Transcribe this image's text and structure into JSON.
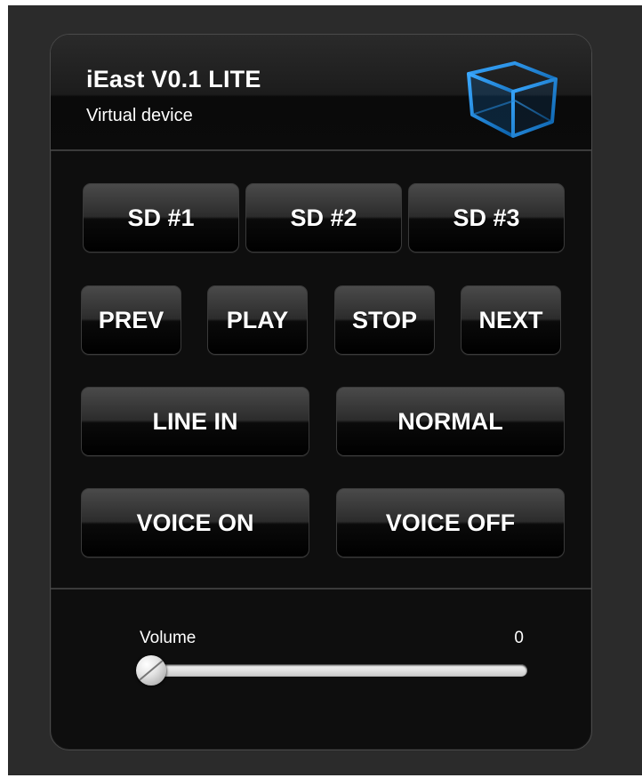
{
  "app": {
    "title": "iEast V0.1 LITE",
    "subtitle": "Virtual device",
    "logo_icon": "cube-icon",
    "accent_color": "#1e8fe0"
  },
  "sd_buttons": [
    "SD #1",
    "SD #2",
    "SD #3"
  ],
  "transport_buttons": [
    "PREV",
    "PLAY",
    "STOP",
    "NEXT"
  ],
  "mode_buttons": [
    "LINE IN",
    "NORMAL"
  ],
  "voice_buttons": [
    "VOICE ON",
    "VOICE OFF"
  ],
  "volume": {
    "label": "Volume",
    "value": "0",
    "level": 0
  }
}
